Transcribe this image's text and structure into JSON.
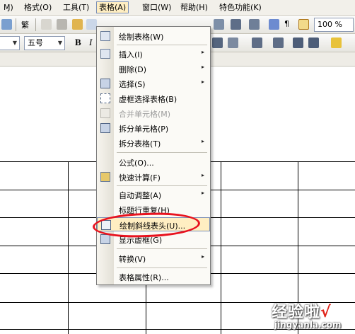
{
  "menubar": {
    "items": [
      {
        "label": "Ɱ)"
      },
      {
        "label": "格式(O)"
      },
      {
        "label": "工具(T)"
      },
      {
        "label": "表格(A)"
      },
      {
        "label": "窗口(W)"
      },
      {
        "label": "帮助(H)"
      },
      {
        "label": "特色功能(K)"
      }
    ]
  },
  "toolbar1": {
    "traditional": "繁",
    "zoom": "100 %"
  },
  "toolbar2": {
    "font_size": "五号",
    "bold": "B",
    "italic": "I"
  },
  "table_menu": {
    "items": [
      {
        "label": "绘制表格(W)",
        "icon": "pencil-table-icon"
      },
      {
        "label": "插入(I)",
        "icon": "insert-table-icon",
        "submenu": "▸"
      },
      {
        "label": "删除(D)",
        "submenu": "▸"
      },
      {
        "label": "选择(S)",
        "icon": "select-table-icon",
        "submenu": "▸"
      },
      {
        "label": "虚框选择表格(B)",
        "icon": "dashed-select-icon"
      },
      {
        "label": "合并单元格(M)",
        "icon": "merge-cells-icon"
      },
      {
        "label": "拆分单元格(P)",
        "icon": "split-cells-icon"
      },
      {
        "label": "拆分表格(T)",
        "submenu": "▸"
      },
      {
        "label": "公式(O)..."
      },
      {
        "label": "快速计算(F)",
        "icon": "quick-calc-icon",
        "submenu": "▸"
      },
      {
        "label": "自动调整(A)",
        "submenu": "▸"
      },
      {
        "label": "标题行重复(H)"
      },
      {
        "label": "绘制斜线表头(U)...",
        "icon": "diagonal-header-icon"
      },
      {
        "label": "显示虚框(G)",
        "icon": "show-gridlines-icon"
      },
      {
        "label": "转换(V)",
        "submenu": "▸"
      },
      {
        "label": "表格属性(R)..."
      }
    ]
  },
  "watermark": {
    "text": "经验啦",
    "check": "√",
    "url": "jingyanla.com"
  },
  "colors": {
    "highlight": "#ffeec2",
    "highlight_border": "#7b8fb5",
    "annotation_red": "#e8121e"
  }
}
